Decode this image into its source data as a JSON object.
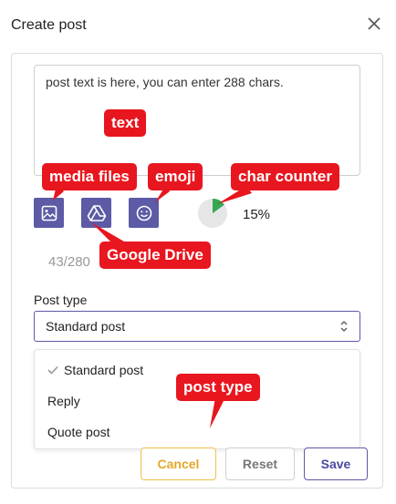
{
  "header": {
    "title": "Create post",
    "close_icon": "close-icon"
  },
  "composer": {
    "text": "post text is here, you can enter 288 chars.",
    "tools": {
      "media_icon": "image-icon",
      "drive_icon": "google-drive-icon",
      "emoji_icon": "emoji-icon"
    },
    "char_counter": {
      "percent_label": "15%",
      "fill_fraction": 0.15,
      "count": "43/280"
    }
  },
  "post_type": {
    "label": "Post type",
    "selected": "Standard post",
    "options": [
      "Standard post",
      "Reply",
      "Quote post"
    ]
  },
  "buttons": {
    "cancel": "Cancel",
    "reset": "Reset",
    "save": "Save"
  },
  "annotations": {
    "text": "text",
    "media": "media files",
    "emoji": "emoji",
    "counter": "char counter",
    "drive": "Google Drive",
    "post_type": "post type"
  },
  "colors": {
    "accent": "#5d5aa6",
    "annotation": "#e8161e",
    "cancel": "#e3a82a",
    "gauge": "#34a853"
  }
}
